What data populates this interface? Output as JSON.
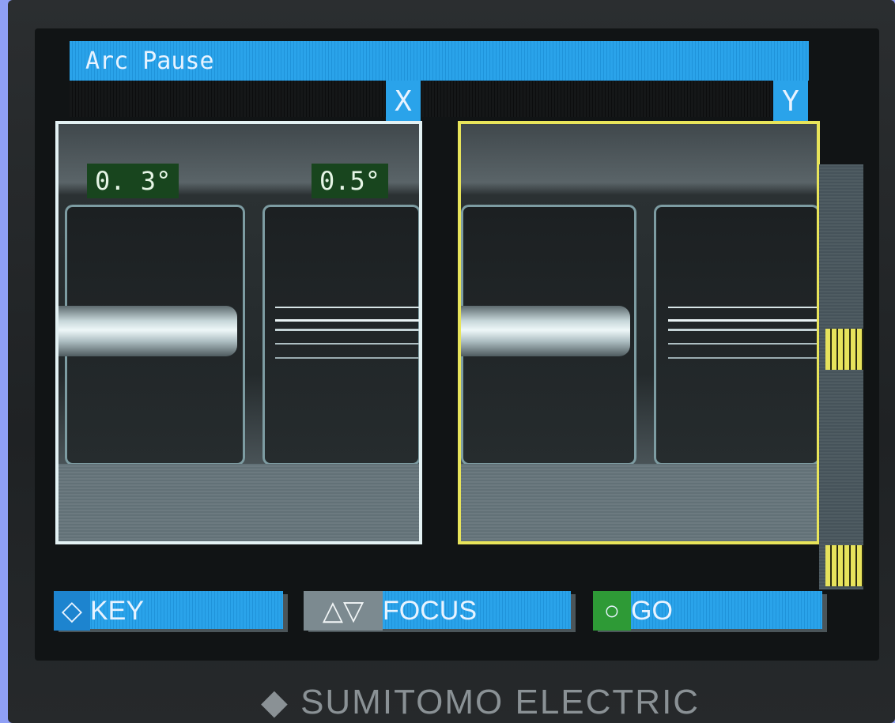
{
  "screen": {
    "title": "Arc Pause"
  },
  "cameras": {
    "x_label": "X",
    "y_label": "Y"
  },
  "angles": {
    "left": "0. 3°",
    "right": "0.5°"
  },
  "softkeys": [
    {
      "icon": "diamond-icon",
      "label": "KEY"
    },
    {
      "icon": "up-down-arrows-icon",
      "label": "FOCUS"
    },
    {
      "icon": "circle-icon",
      "label": "GO"
    }
  ],
  "brand": {
    "text": "SUMITOMO ELECTRIC"
  },
  "colors": {
    "title_bar": "#2aa3ea",
    "x_frame": "#e3f1f3",
    "y_frame": "#e8e45a",
    "angle_bg": "#18451e",
    "go_icon_bg": "#2e9a36"
  }
}
